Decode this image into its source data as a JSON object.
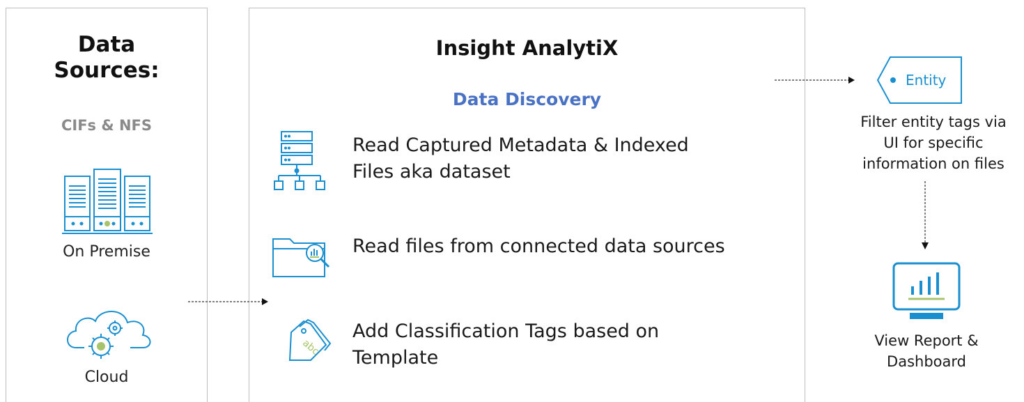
{
  "data_sources": {
    "title_line1": "Data",
    "title_line2": "Sources:",
    "subtitle": "CIFs & NFS",
    "on_premise_label": "On Premise",
    "cloud_label": "Cloud"
  },
  "insight": {
    "title": "Insight AnalytiX",
    "subtitle": "Data Discovery",
    "steps": [
      {
        "icon": "server-hierarchy-icon",
        "line1": "Read Captured Metadata & Indexed",
        "line2": "Files aka dataset"
      },
      {
        "icon": "folder-search-icon",
        "line1": "Read files from connected data sources",
        "line2": ""
      },
      {
        "icon": "abc-tag-icon",
        "line1": "Add Classification Tags based on",
        "line2": "Template"
      }
    ]
  },
  "output": {
    "entity_tag": "Entity",
    "filter_line1": "Filter entity tags via",
    "filter_line2": "UI for specific",
    "filter_line3": "information on files",
    "report_line1": "View Report &",
    "report_line2": "Dashboard"
  },
  "colors": {
    "accent_blue": "#1a8fd0",
    "title_blue": "#4a72c4",
    "gray": "#8a8a8a",
    "chart_green": "#a8c46a"
  }
}
